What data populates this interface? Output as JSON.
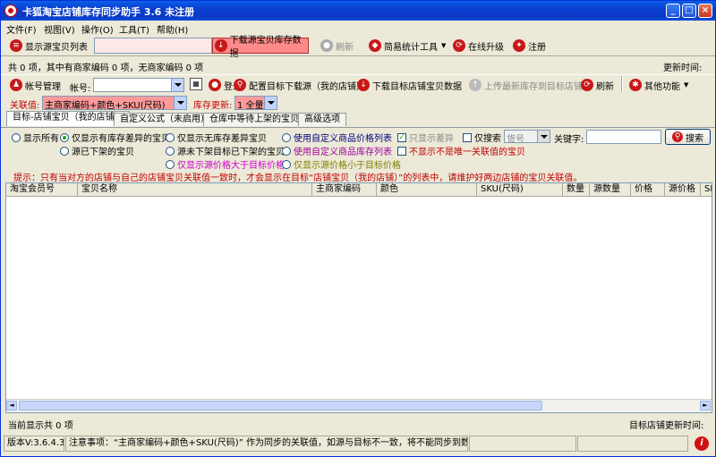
{
  "window": {
    "title": "卡狐淘宝店铺库存同步助手  3.6  未注册"
  },
  "menu": [
    "文件(F)",
    "视图(V)",
    "操作(O)",
    "工具(T)",
    "帮助(H)"
  ],
  "toolbar1": {
    "show_source": "显示源宝贝列表",
    "download_source": "下载源宝贝库存数据",
    "refresh": "刷新",
    "stats": "简易统计工具",
    "upgrade": "在线升级",
    "register": "注册"
  },
  "info": {
    "summary": "共 0 项，其中有商家编码 0 项，无商家编码 0 项",
    "update_time_label": "更新时间:"
  },
  "toolbar2": {
    "account_manage": "帐号管理",
    "account_label": "帐号:",
    "account_value": "",
    "login": "登录",
    "config_target": "配置目标下载源（我的店铺）",
    "download_target": "下载目标店铺宝贝数据",
    "upload_stock": "上传最新库存到目标店铺",
    "refresh": "刷新",
    "other": "其他功能"
  },
  "keyrow": {
    "key_label": "关联值:",
    "key_value": "主商家编码+颜色+SKU(尺码)",
    "stock_label": "库存更新:",
    "stock_value": "1 全量"
  },
  "tabs": [
    "目标-店铺宝贝（我的店铺）",
    "自定义公式（未启用）",
    "仓库中等待上架的宝贝",
    "高级选项"
  ],
  "filters": {
    "show_all": "显示所有",
    "only_diff_stock": "仅显示有库存差异的宝贝",
    "only_no_stock_diff": "仅显示无库存差异宝贝",
    "custom_price_list": "使用自定义商品价格列表",
    "source_offshelf": "源已下架的宝贝",
    "source_not_offshelf": "源未下架目标已下架的宝贝",
    "custom_stock_list": "使用自定义商品库存列表",
    "source_price_gt": "仅显示源价格大于目标价格",
    "source_price_lt": "仅显示源价格小于目标价格",
    "only_diff_chk": "只显示差异",
    "search_chk": "仅搜索",
    "search_field_value": "货号",
    "keyword_label": "关键字:",
    "keyword_value": "",
    "search_btn": "搜索",
    "not_unique": "不显示不是唯一关联值的宝贝"
  },
  "hint": "提示：只有当对方的店铺与自己的店铺宝贝关联值一致时，才会显示在目标“店铺宝贝（我的店铺）”的列表中，请维护好两边店铺的宝贝关联值。",
  "grid_columns": [
    "淘宝会员号",
    "宝贝名称",
    "主商家编码",
    "颜色",
    "SKU(尺码)",
    "数量",
    "源数量",
    "价格",
    "源价格",
    "SK"
  ],
  "footer": {
    "current_count": "当前显示共 0 项",
    "target_update": "目标店铺更新时间:",
    "version": "版本V:3.6.4.3",
    "notice": "注意事项：“主商家编码+颜色+SKU(尺码)” 作为同步的关联值，如源与目标不一致，将不能同步到数据。"
  }
}
